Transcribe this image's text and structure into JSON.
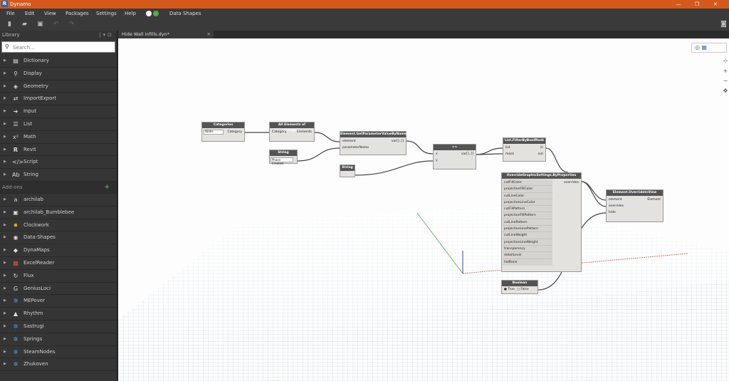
{
  "app": {
    "title": "Dynamo",
    "logo_letter": "R",
    "min": "—",
    "restore": "❐",
    "close": "✕"
  },
  "menu": [
    "File",
    "Edit",
    "View",
    "Packages",
    "Settings",
    "Help",
    "Data Shapes"
  ],
  "library": {
    "title": "Library",
    "search_placeholder": "Search...",
    "categories": [
      "Dictionary",
      "Display",
      "Geometry",
      "ImportExport",
      "Input",
      "List",
      "Math",
      "Revit",
      "Script",
      "String"
    ],
    "addons_title": "Add-ons",
    "addons": [
      "archilab",
      "archilab_Bumblebee",
      "Clockwork",
      "Data-Shapes",
      "DynaMaps",
      "ExcelReader",
      "Flux",
      "GeniusLoci",
      "MEPover",
      "Rhythm",
      "Sastrugi",
      "Springs",
      "SteamNodes",
      "Zhukoven"
    ]
  },
  "tab": {
    "name": "Hide Wall infills.dyn*",
    "close": "✕"
  },
  "nodes": {
    "categories": {
      "title": "Categories",
      "value": "Walls",
      "out": "Category"
    },
    "all_elements": {
      "title": "All Elements of Category",
      "in": "Category",
      "out": "Elements"
    },
    "get_param": {
      "title": "Element.GetParameterValueByName",
      "in1": "element",
      "in2": "parameterName",
      "out": "var[]..[]"
    },
    "string1": {
      "title": "String",
      "value": "Phase Created"
    },
    "string2": {
      "title": "String"
    },
    "equals": {
      "title": "==",
      "in1": "x",
      "in2": "y",
      "out": "var[]..[]"
    },
    "filter": {
      "title": "List.FilterByBoolMask",
      "in1": "list",
      "in2": "mask",
      "out1": "in",
      "out2": "out"
    },
    "override": {
      "title": "OverrideGraphicSettings.ByProperties",
      "inputs": [
        "cutFillColor",
        "projectionFillColor",
        "cutLineColor",
        "projectionLineColor",
        "cutFillPattern",
        "projectionFillPattern",
        "cutLinePattern",
        "projectionLinePattern",
        "cutLineWeight",
        "projectionLineWeight",
        "transparency",
        "detailLevel",
        "halftone"
      ],
      "out": "overrides"
    },
    "boolean": {
      "title": "Boolean",
      "opt1": "True",
      "opt2": "False"
    },
    "override_in_view": {
      "title": "Element.OverrideInView",
      "in1": "element",
      "in2": "overrides",
      "in3": "hide",
      "out": "Element"
    }
  }
}
